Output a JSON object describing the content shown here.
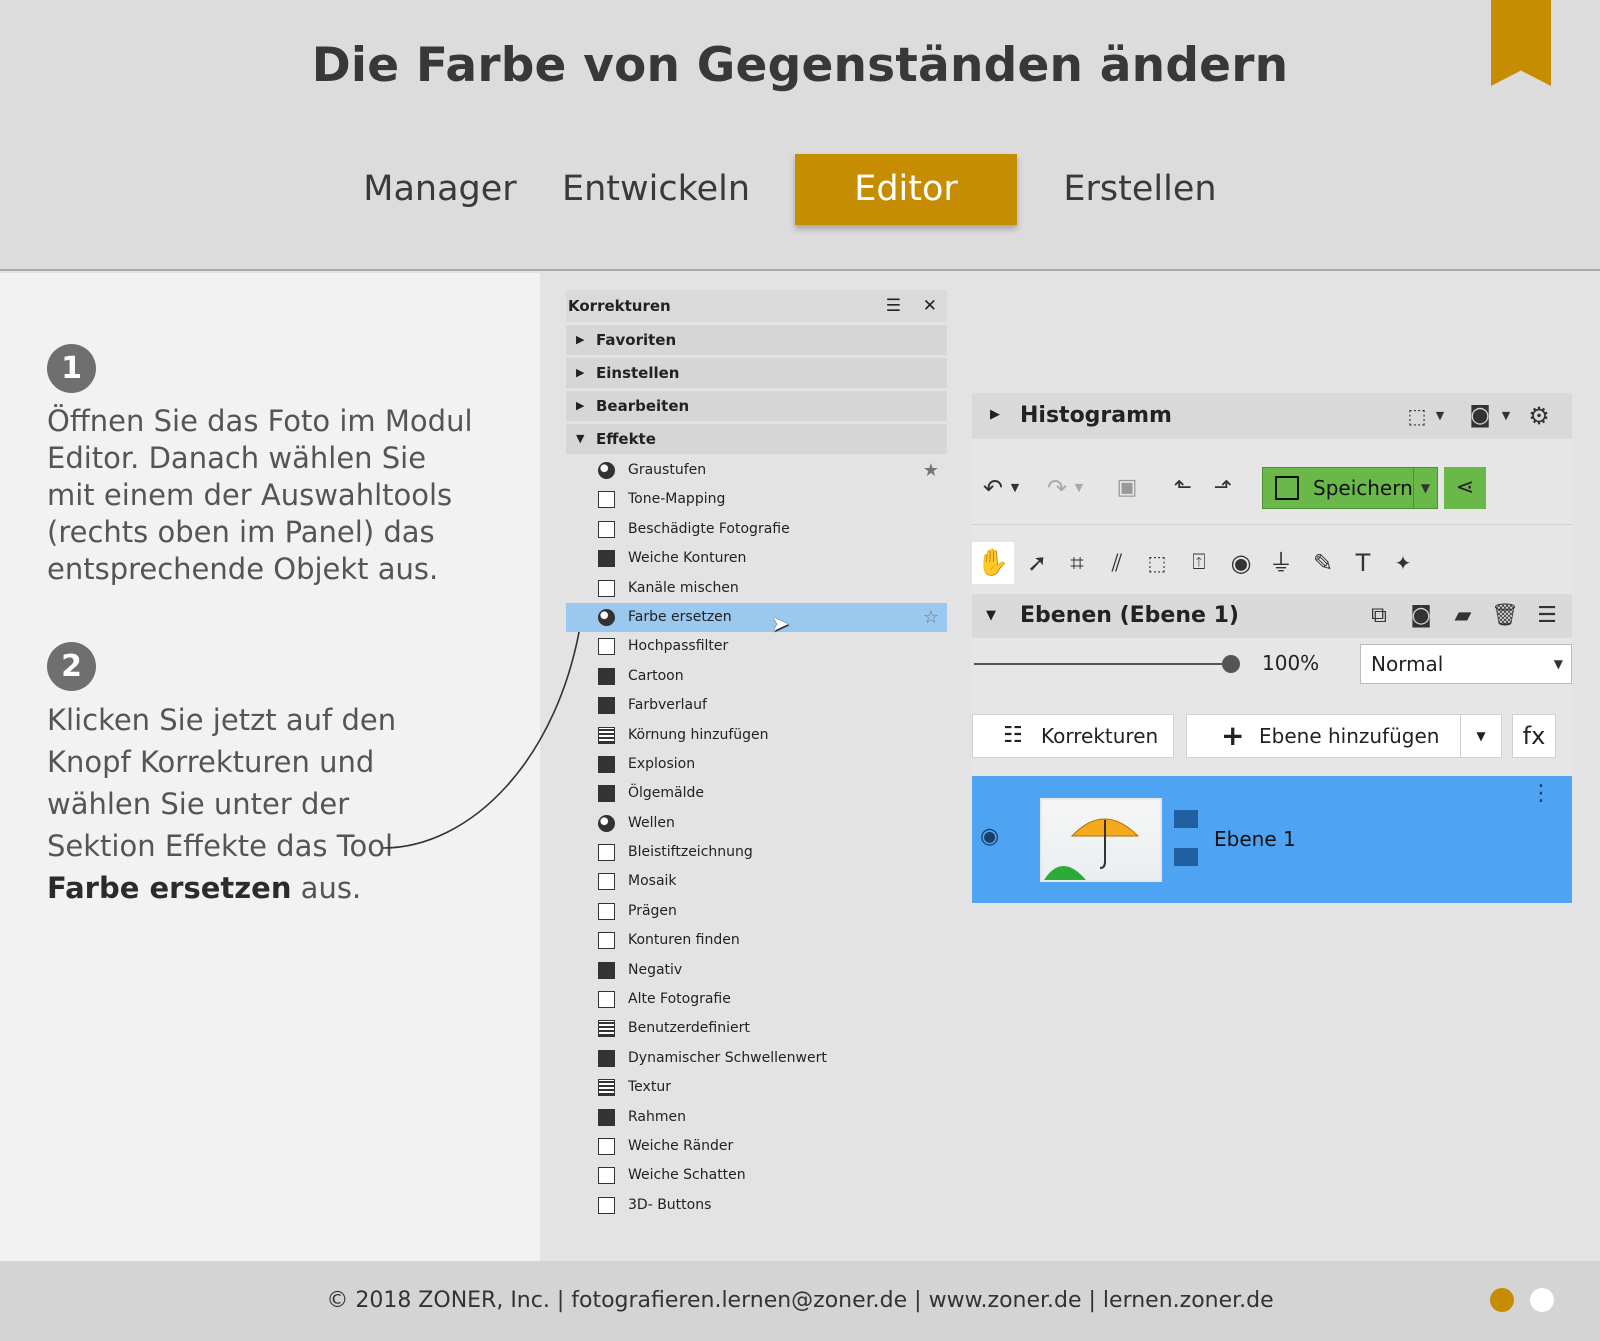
{
  "title": "Die Farbe von Gegenständen ändern",
  "modules": [
    {
      "label": "Manager"
    },
    {
      "label": "Entwickeln"
    },
    {
      "label": "Editor",
      "active": true
    },
    {
      "label": "Erstellen"
    }
  ],
  "steps": [
    {
      "number": "1",
      "lines": [
        "Öffnen Sie das Foto im Modul",
        "Editor. Danach wählen Sie",
        "mit einem der Auswahltools",
        "(rechts oben im Panel) das",
        "entsprechende Objekt aus."
      ]
    },
    {
      "number": "2",
      "lines": [
        "Klicken Sie jetzt auf den",
        "Knopf Korrekturen und",
        "wählen Sie unter der",
        "Sektion Effekte das Tool"
      ],
      "bold": "Farbe ersetzen",
      "tail": " aus."
    }
  ],
  "korrekturen": {
    "title": "Korrekturen",
    "sections": [
      "Favoriten",
      "Einstellen",
      "Bearbeiten",
      "Effekte"
    ],
    "effects": [
      {
        "label": "Graustufen",
        "icon": "graustufen-icon",
        "star": "★"
      },
      {
        "label": "Tone-Mapping",
        "icon": "tone-mapping-icon"
      },
      {
        "label": "Beschädigte Fotografie",
        "icon": "damaged-photo-icon"
      },
      {
        "label": "Weiche Konturen",
        "icon": "soft-contours-icon"
      },
      {
        "label": "Kanäle mischen",
        "icon": "mix-channels-icon"
      },
      {
        "label": "Farbe ersetzen",
        "icon": "replace-color-icon",
        "star": "☆",
        "selected": true
      },
      {
        "label": "Hochpassfilter",
        "icon": "highpass-icon"
      },
      {
        "label": "Cartoon",
        "icon": "cartoon-icon"
      },
      {
        "label": "Farbverlauf",
        "icon": "gradient-icon"
      },
      {
        "label": "Körnung hinzufügen",
        "icon": "grain-icon"
      },
      {
        "label": "Explosion",
        "icon": "explosion-icon"
      },
      {
        "label": "Ölgemälde",
        "icon": "oil-paint-icon"
      },
      {
        "label": "Wellen",
        "icon": "waves-icon"
      },
      {
        "label": "Bleistiftzeichnung",
        "icon": "pencil-icon"
      },
      {
        "label": "Mosaik",
        "icon": "mosaic-icon"
      },
      {
        "label": "Prägen",
        "icon": "emboss-icon"
      },
      {
        "label": "Konturen finden",
        "icon": "find-edges-icon"
      },
      {
        "label": "Negativ",
        "icon": "negative-icon"
      },
      {
        "label": "Alte Fotografie",
        "icon": "old-photo-icon"
      },
      {
        "label": "Benutzerdefiniert",
        "icon": "custom-icon"
      },
      {
        "label": "Dynamischer Schwellenwert",
        "icon": "threshold-icon"
      },
      {
        "label": "Textur",
        "icon": "texture-icon"
      },
      {
        "label": "Rahmen",
        "icon": "frame-icon"
      },
      {
        "label": "Weiche Ränder",
        "icon": "soft-edges-icon"
      },
      {
        "label": "Weiche Schatten",
        "icon": "soft-shadow-icon"
      },
      {
        "label": "3D- Buttons",
        "icon": "3d-buttons-icon"
      }
    ]
  },
  "editor": {
    "histogram_title": "Histogramm",
    "save_label": "Speichern",
    "layers_title": "Ebenen (Ebene 1)",
    "opacity": "100%",
    "blend_mode": "Normal",
    "korrekturen_button": "Korrekturen",
    "add_layer_button": "Ebene hinzufügen",
    "fx_button": "fx",
    "layer_name": "Ebene 1"
  },
  "footer": "© 2018 ZONER, Inc.  |  fotografieren.lernen@zoner.de  |  www.zoner.de  |  lernen.zoner.de",
  "colors": {
    "accent": "#c78d02",
    "selection": "#9bc8ee",
    "layer_row": "#4ea4f2",
    "save": "#6bb84a"
  }
}
